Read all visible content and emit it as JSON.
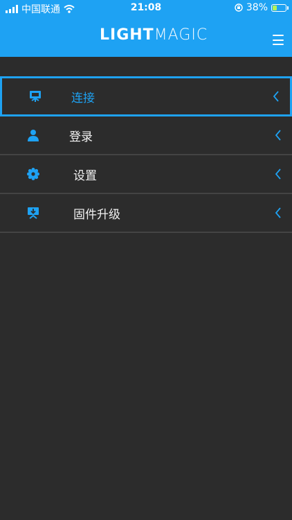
{
  "status_bar": {
    "carrier": "中国联通",
    "time": "21:08",
    "battery": "38%",
    "battery_level": 0.38
  },
  "header": {
    "logo_bold": "LIGHT",
    "logo_thin": "MAGIC",
    "menu_icon": "hamburger-icon"
  },
  "colors": {
    "accent": "#1ea2f3",
    "background": "#2c2c2c",
    "divider": "#444444"
  },
  "menu": {
    "items": [
      {
        "label": "连接",
        "icon": "connect-icon",
        "active": true
      },
      {
        "label": "登录",
        "icon": "user-icon",
        "active": false
      },
      {
        "label": "设置",
        "icon": "gear-icon",
        "active": false
      },
      {
        "label": "固件升级",
        "icon": "firmware-upgrade-icon",
        "active": false
      }
    ]
  }
}
